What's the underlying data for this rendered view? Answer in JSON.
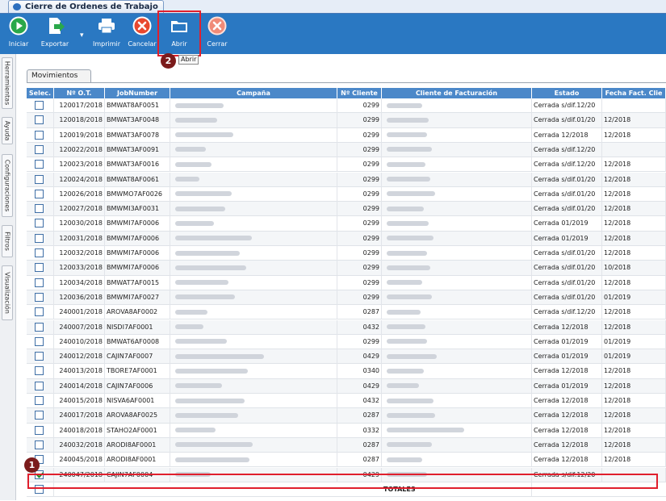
{
  "window": {
    "tab_title": "Cierre de Ordenes de Trabajo"
  },
  "toolbar": {
    "buttons": [
      {
        "label": "Iniciar"
      },
      {
        "label": "Exportar"
      },
      {
        "label": "Imprimir"
      },
      {
        "label": "Cancelar"
      },
      {
        "label": "Abrir"
      },
      {
        "label": "Cerrar"
      }
    ],
    "tooltip": "Abrir"
  },
  "sidebar": {
    "tabs": [
      "Herramientas",
      "Ayuda",
      "Configuraciones",
      "Filtros",
      "Visualización"
    ]
  },
  "subtab": "Movimientos",
  "grid": {
    "columns": [
      "Selec.",
      "Nº O.T.",
      "JobNumber",
      "Campaña",
      "Nº Cliente",
      "Cliente de Facturación",
      "Estado",
      "Fecha Fact. Clie"
    ],
    "rows": [
      {
        "ot": "120017/2018",
        "job": "BMWAT8AF0051",
        "cliente": "0299",
        "estado": "Cerrada s/dif.12/20",
        "fecha": "",
        "checked": false
      },
      {
        "ot": "120018/2018",
        "job": "BMWAT3AF0048",
        "cliente": "0299",
        "estado": "Cerrada s/dif.01/20",
        "fecha": "12/2018",
        "checked": false
      },
      {
        "ot": "120019/2018",
        "job": "BMWAT3AF0078",
        "cliente": "0299",
        "estado": "Cerrada 12/2018",
        "fecha": "12/2018",
        "checked": false
      },
      {
        "ot": "120022/2018",
        "job": "BMWAT3AF0091",
        "cliente": "0299",
        "estado": "Cerrada s/dif.12/20",
        "fecha": "",
        "checked": false
      },
      {
        "ot": "120023/2018",
        "job": "BMWAT3AF0016",
        "cliente": "0299",
        "estado": "Cerrada s/dif.12/20",
        "fecha": "12/2018",
        "checked": false
      },
      {
        "ot": "120024/2018",
        "job": "BMWAT8AF0061",
        "cliente": "0299",
        "estado": "Cerrada s/dif.01/20",
        "fecha": "12/2018",
        "checked": false
      },
      {
        "ot": "120026/2018",
        "job": "BMWMO7AF0026",
        "cliente": "0299",
        "estado": "Cerrada s/dif.01/20",
        "fecha": "12/2018",
        "checked": false
      },
      {
        "ot": "120027/2018",
        "job": "BMWMI3AF0031",
        "cliente": "0299",
        "estado": "Cerrada s/dif.01/20",
        "fecha": "12/2018",
        "checked": false
      },
      {
        "ot": "120030/2018",
        "job": "BMWMI7AF0006",
        "cliente": "0299",
        "estado": "Cerrada 01/2019",
        "fecha": "12/2018",
        "checked": false
      },
      {
        "ot": "120031/2018",
        "job": "BMWMI7AF0006",
        "cliente": "0299",
        "estado": "Cerrada 01/2019",
        "fecha": "12/2018",
        "checked": false
      },
      {
        "ot": "120032/2018",
        "job": "BMWMI7AF0006",
        "cliente": "0299",
        "estado": "Cerrada s/dif.01/20",
        "fecha": "12/2018",
        "checked": false
      },
      {
        "ot": "120033/2018",
        "job": "BMWMI7AF0006",
        "cliente": "0299",
        "estado": "Cerrada s/dif.01/20",
        "fecha": "10/2018",
        "checked": false
      },
      {
        "ot": "120034/2018",
        "job": "BMWAT7AF0015",
        "cliente": "0299",
        "estado": "Cerrada s/dif.01/20",
        "fecha": "12/2018",
        "checked": false
      },
      {
        "ot": "120036/2018",
        "job": "BMWMI7AF0027",
        "cliente": "0299",
        "estado": "Cerrada s/dif.01/20",
        "fecha": "01/2019",
        "checked": false
      },
      {
        "ot": "240001/2018",
        "job": "AROVA8AF0002",
        "cliente": "0287",
        "estado": "Cerrada s/dif.12/20",
        "fecha": "12/2018",
        "checked": false
      },
      {
        "ot": "240007/2018",
        "job": "NISDI7AF0001",
        "cliente": "0432",
        "estado": "Cerrada 12/2018",
        "fecha": "12/2018",
        "checked": false
      },
      {
        "ot": "240010/2018",
        "job": "BMWAT6AF0008",
        "cliente": "0299",
        "estado": "Cerrada 01/2019",
        "fecha": "01/2019",
        "checked": false
      },
      {
        "ot": "240012/2018",
        "job": "CAJIN7AF0007",
        "cliente": "0429",
        "estado": "Cerrada 01/2019",
        "fecha": "01/2019",
        "checked": false
      },
      {
        "ot": "240013/2018",
        "job": "TBORE7AF0001",
        "cliente": "0340",
        "estado": "Cerrada 12/2018",
        "fecha": "12/2018",
        "checked": false
      },
      {
        "ot": "240014/2018",
        "job": "CAJIN7AF0006",
        "cliente": "0429",
        "estado": "Cerrada 01/2019",
        "fecha": "12/2018",
        "checked": false
      },
      {
        "ot": "240015/2018",
        "job": "NISVA6AF0001",
        "cliente": "0432",
        "estado": "Cerrada 12/2018",
        "fecha": "12/2018",
        "checked": false
      },
      {
        "ot": "240017/2018",
        "job": "AROVA8AF0025",
        "cliente": "0287",
        "estado": "Cerrada 12/2018",
        "fecha": "12/2018",
        "checked": false
      },
      {
        "ot": "240018/2018",
        "job": "STAHO2AF0001",
        "cliente": "0332",
        "estado": "Cerrada 12/2018",
        "fecha": "12/2018",
        "checked": false
      },
      {
        "ot": "240032/2018",
        "job": "ARODI8AF0001",
        "cliente": "0287",
        "estado": "Cerrada 12/2018",
        "fecha": "12/2018",
        "checked": false
      },
      {
        "ot": "240045/2018",
        "job": "ARODI8AF0001",
        "cliente": "0287",
        "estado": "Cerrada 12/2018",
        "fecha": "12/2018",
        "checked": false
      },
      {
        "ot": "240047/2018",
        "job": "CAJIN7AF0004",
        "cliente": "0429",
        "estado": "Cerrada s/dif.12/20",
        "fecha": "",
        "checked": true
      }
    ],
    "totals_label": "TOTALES"
  },
  "annotations": {
    "badge1": "1",
    "badge2": "2"
  }
}
